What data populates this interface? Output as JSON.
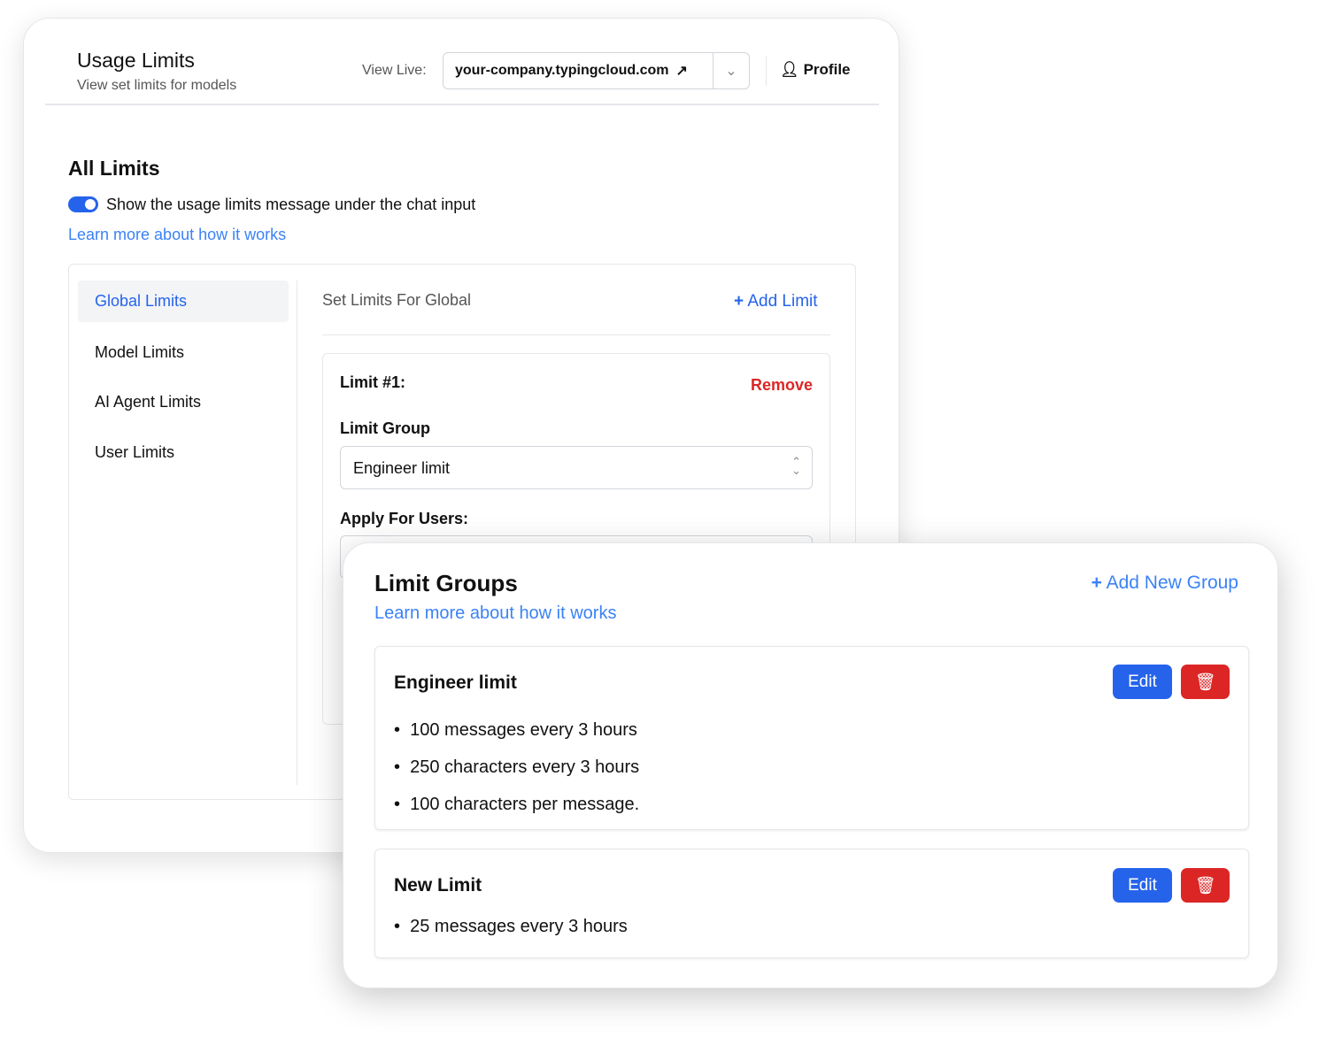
{
  "header": {
    "title": "Usage Limits",
    "subtitle": "View set limits for models",
    "view_live_label": "View Live:",
    "domain": "your-company.typingcloud.com",
    "profile": "Profile"
  },
  "all_limits": {
    "title": "All Limits",
    "toggle_label": "Show the usage limits message under the chat input",
    "toggle_on": true,
    "learn_more": "Learn more about how it works"
  },
  "sidebar": {
    "items": [
      {
        "label": "Global Limits",
        "active": true
      },
      {
        "label": "Model Limits"
      },
      {
        "label": "AI Agent Limits"
      },
      {
        "label": "User Limits"
      }
    ]
  },
  "panel": {
    "title": "Set Limits For Global",
    "add_limit": "Add Limit",
    "limit_title": "Limit #1:",
    "remove": "Remove",
    "group_label": "Limit Group",
    "group_value": "Engineer limit",
    "apply_label": "Apply For Users:"
  },
  "groups": {
    "title": "Limit Groups",
    "learn_more": "Learn more about how it works",
    "add_new": "Add New Group",
    "edit": "Edit",
    "items": [
      {
        "name": "Engineer limit",
        "rules": [
          "100 messages every 3 hours",
          "250 characters every 3 hours",
          "100 characters per message."
        ]
      },
      {
        "name": "New Limit",
        "rules": [
          "25 messages every 3 hours"
        ]
      }
    ]
  },
  "colors": {
    "accent": "#2563eb",
    "danger": "#dc2626",
    "link": "#3b82f6"
  }
}
